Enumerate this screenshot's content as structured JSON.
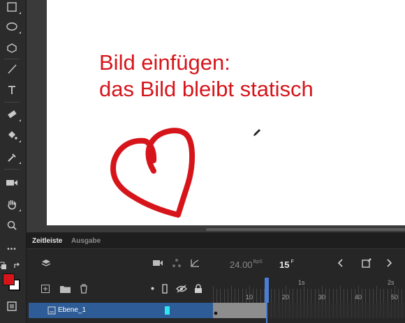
{
  "stage": {
    "text_line1": "Bild einfügen:",
    "text_line2": "das Bild bleibt statisch",
    "accent_color": "#d6151b"
  },
  "toolbar": {
    "tools": [
      "rectangle-tool-icon",
      "oval-tool-icon",
      "polystar-tool-icon",
      "line-tool-icon",
      "text-tool-icon",
      "eraser-tool-icon",
      "paint-bucket-icon",
      "eyedropper-icon",
      "camera-icon",
      "hand-tool-icon",
      "zoom-tool-icon"
    ],
    "more": "•••",
    "fill_color": "#d6151b",
    "stroke_color": "#ffffff"
  },
  "timeline": {
    "tabs": [
      "Zeitleiste",
      "Ausgabe"
    ],
    "fps_value": "24.00",
    "fps_unit": "BpS",
    "current_frame": "15",
    "frame_unit": "F",
    "ruler_labels": [
      "10",
      "20",
      "30",
      "40",
      "50"
    ],
    "second_labels": [
      "1s",
      "2s"
    ],
    "layer": {
      "name": "Ebene_1",
      "color": "#2ee6f0"
    }
  }
}
